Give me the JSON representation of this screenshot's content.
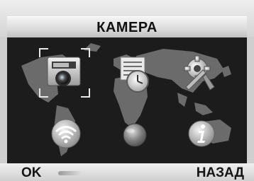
{
  "screen": {
    "title": "КАМЕРА"
  },
  "menu": {
    "selected_index": 0,
    "items": [
      {
        "icon": "camera-icon"
      },
      {
        "icon": "calendar-clock-icon"
      },
      {
        "icon": "settings-tools-icon"
      },
      {
        "icon": "wifi-icon"
      },
      {
        "icon": "globe-icon"
      },
      {
        "icon": "info-icon"
      }
    ]
  },
  "softkeys": {
    "left": "OK",
    "right": "НАЗАД"
  },
  "colors": {
    "panel": "#1c1c1c",
    "map_land": "#6e6e6e",
    "header": "#d8d8d8"
  }
}
